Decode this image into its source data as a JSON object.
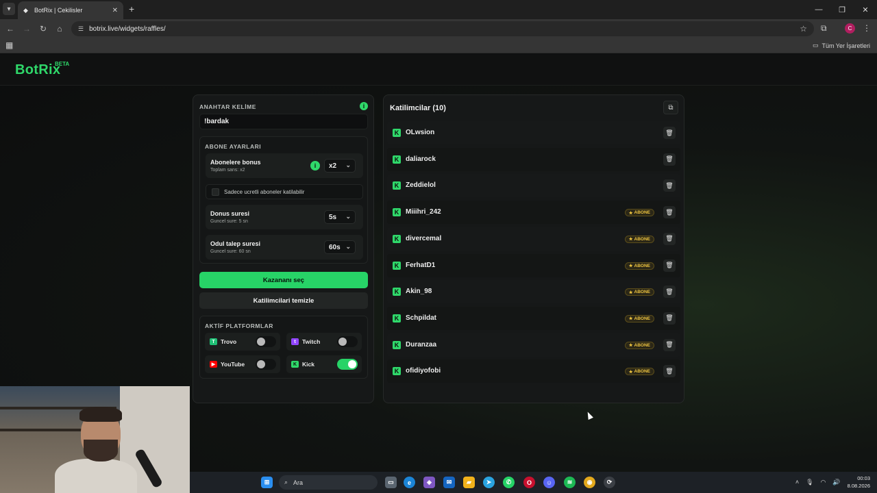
{
  "browser": {
    "tab_title": "BotRix | Cekilisler",
    "url": "botrix.live/widgets/raffles/",
    "bookmarks_label": "Tüm Yer İşaretleri",
    "profile_initial": "C"
  },
  "site": {
    "logo": "BotRix",
    "logo_badge": "BETA"
  },
  "settings": {
    "keyword_label": "ANAHTAR KELİME",
    "keyword_value": "!bardak",
    "subs_section_label": "ABONE AYARLARI",
    "bonus_title": "Abonelere bonus",
    "bonus_sub": "Toplam sans: x2",
    "bonus_value": "x2",
    "paid_only_label": "Sadece ucretli aboneler katilabilir",
    "paid_only_checked": false,
    "bonus_duration_title": "Donus suresi",
    "bonus_duration_sub": "Guncel sure: 5 sn",
    "bonus_duration_value": "5s",
    "claim_title": "Odul talep suresi",
    "claim_sub": "Guncel sure: 60 sn",
    "claim_value": "60s",
    "pick_winner_label": "Kazananı seç",
    "clear_label": "Katilimcilari temizle",
    "platforms_label": "AKTİF PLATFORMLAR",
    "platforms": [
      {
        "name": "Trovo",
        "enabled": false,
        "color": "#1fbf75"
      },
      {
        "name": "Twitch",
        "enabled": false,
        "color": "#9146ff"
      },
      {
        "name": "YouTube",
        "enabled": false,
        "color": "#ff0000"
      },
      {
        "name": "Kick",
        "enabled": true,
        "color": "#53fc18"
      }
    ]
  },
  "participants": {
    "title": "Katilimcilar (10)",
    "badge_label": "ABONE",
    "list": [
      {
        "name": "OLwsion",
        "subscriber": false
      },
      {
        "name": "daliarock",
        "subscriber": false
      },
      {
        "name": "Zeddielol",
        "subscriber": false
      },
      {
        "name": "Miiihri_242",
        "subscriber": true
      },
      {
        "name": "divercemal",
        "subscriber": true
      },
      {
        "name": "FerhatD1",
        "subscriber": true
      },
      {
        "name": "Akin_98",
        "subscriber": true
      },
      {
        "name": "Schpildat",
        "subscriber": true
      },
      {
        "name": "Duranzaa",
        "subscriber": true
      },
      {
        "name": "ofidiyofobi",
        "subscriber": true
      }
    ]
  },
  "taskbar": {
    "search_placeholder": "Ara",
    "time": "00:03",
    "date": "8.08.2026"
  },
  "colors": {
    "accent": "#27d367",
    "badge": "#f0c640"
  }
}
